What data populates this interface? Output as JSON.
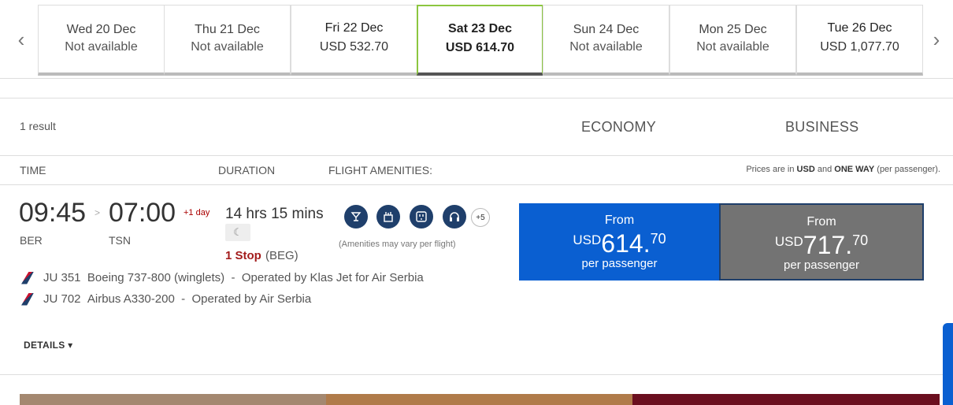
{
  "date_bar": {
    "prev_icon": "chevron-left-icon",
    "next_icon": "chevron-right-icon",
    "dates": [
      {
        "label": "Wed 20 Dec",
        "price": "Not available"
      },
      {
        "label": "Thu 21 Dec",
        "price": "Not available"
      },
      {
        "label": "Fri 22 Dec",
        "price": "USD 532.70"
      },
      {
        "label": "Sat 23 Dec",
        "price": "USD 614.70"
      },
      {
        "label": "Sun 24 Dec",
        "price": "Not available"
      },
      {
        "label": "Mon 25 Dec",
        "price": "Not available"
      },
      {
        "label": "Tue 26 Dec",
        "price": "USD 1,077.70"
      }
    ],
    "selected_index": 3
  },
  "results": {
    "count_text": "1 result",
    "cabins": {
      "economy": "ECONOMY",
      "business": "BUSINESS"
    }
  },
  "columns": {
    "time": "TIME",
    "duration": "DURATION",
    "amenities": "FLIGHT AMENITIES:",
    "price_note_prefix": "Prices are in",
    "price_note_currency": "USD",
    "price_note_mid": "and",
    "price_note_way": "ONE WAY",
    "price_note_suffix": "(per passenger)."
  },
  "flight": {
    "depart_time": "09:45",
    "arrive_time": "07:00",
    "day_offset": "+1 day",
    "depart_airport": "BER",
    "arrive_airport": "TSN",
    "duration": "14 hrs 15 mins",
    "stops": "1 Stop",
    "stop_city": "(BEG)",
    "amenities": [
      "drink-icon",
      "meal-icon",
      "power-outlet-icon",
      "headphones-icon"
    ],
    "amenities_more": "+5",
    "amenities_note": "(Amenities may vary per flight)",
    "segments": [
      {
        "flight": "JU 351",
        "aircraft": "Boeing 737-800 (winglets)",
        "operator": "Operated by Klas Jet for Air Serbia"
      },
      {
        "flight": "JU 702",
        "aircraft": "Airbus A330-200",
        "operator": "Operated by Air Serbia"
      }
    ],
    "details_label": "DETAILS ▾"
  },
  "fares": {
    "economy": {
      "from": "From",
      "currency": "USD",
      "whole": "614.",
      "cents": "70",
      "per": "per passenger"
    },
    "business": {
      "from": "From",
      "currency": "USD",
      "whole": "717.",
      "cents": "70",
      "per": "per passenger"
    }
  },
  "colors": {
    "economy_button": "#0a5fd1",
    "business_button": "#737373",
    "selected_date_border": "#8cc63f",
    "stop_text": "#a31c1c"
  }
}
